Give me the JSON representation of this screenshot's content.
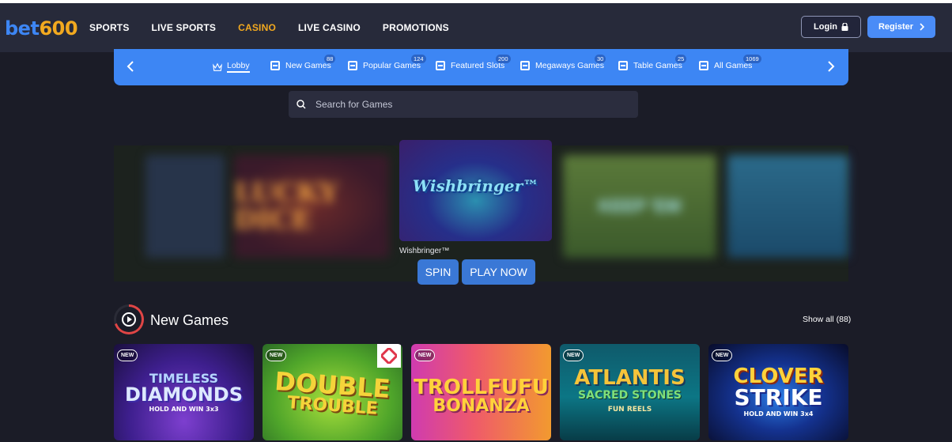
{
  "header": {
    "logo": {
      "part1": "bet",
      "part2": "600"
    },
    "nav": [
      "SPORTS",
      "LIVE SPORTS",
      "CASINO",
      "LIVE CASINO",
      "PROMOTIONS"
    ],
    "active_nav": "CASINO",
    "login_label": "Login",
    "register_label": "Register"
  },
  "categories": [
    {
      "label": "Lobby",
      "icon": "crown-icon",
      "count": null
    },
    {
      "label": "New Games",
      "icon": "grid-icon",
      "count": "88"
    },
    {
      "label": "Popular Games",
      "icon": "grid-icon",
      "count": "124"
    },
    {
      "label": "Featured Slots",
      "icon": "grid-icon",
      "count": "200"
    },
    {
      "label": "Megaways Games",
      "icon": "grid-icon",
      "count": "30"
    },
    {
      "label": "Table Games",
      "icon": "grid-icon",
      "count": "25"
    },
    {
      "label": "All Games",
      "icon": "grid-icon",
      "count": "1069"
    }
  ],
  "search": {
    "placeholder": "Search for Games"
  },
  "carousel": {
    "featured": {
      "title_art": "Wishbringer™",
      "name": "Wishbringer™"
    },
    "blurred": [
      "LUCKY DICE",
      "KEEP 'EM"
    ],
    "spin_label": "SPIN",
    "play_label": "PLAY NOW"
  },
  "new_games": {
    "title": "New Games",
    "show_all": "Show all (88)",
    "games": [
      {
        "badge": "NEW",
        "line1": "TIMELESS",
        "line2": "DIAMONDS",
        "sub": "HOLD AND WIN 3x3"
      },
      {
        "badge": "NEW",
        "line1": "DOUBLE",
        "line2": "TROUBLE",
        "sub": ""
      },
      {
        "badge": "NEW",
        "line1": "TROLLFUFU",
        "line2": "BONANZA",
        "sub": ""
      },
      {
        "badge": "NEW",
        "line1": "ATLANTIS",
        "line2": "SACRED STONES",
        "sub": "FUN REELS"
      },
      {
        "badge": "NEW",
        "line1": "CLOVER",
        "line2": "STRIKE",
        "sub": "HOLD AND WIN 3x4"
      }
    ]
  },
  "colors": {
    "accent": "#3d86f4",
    "active": "#f2a91f",
    "background": "#1b1c27",
    "header": "#272a3a"
  }
}
